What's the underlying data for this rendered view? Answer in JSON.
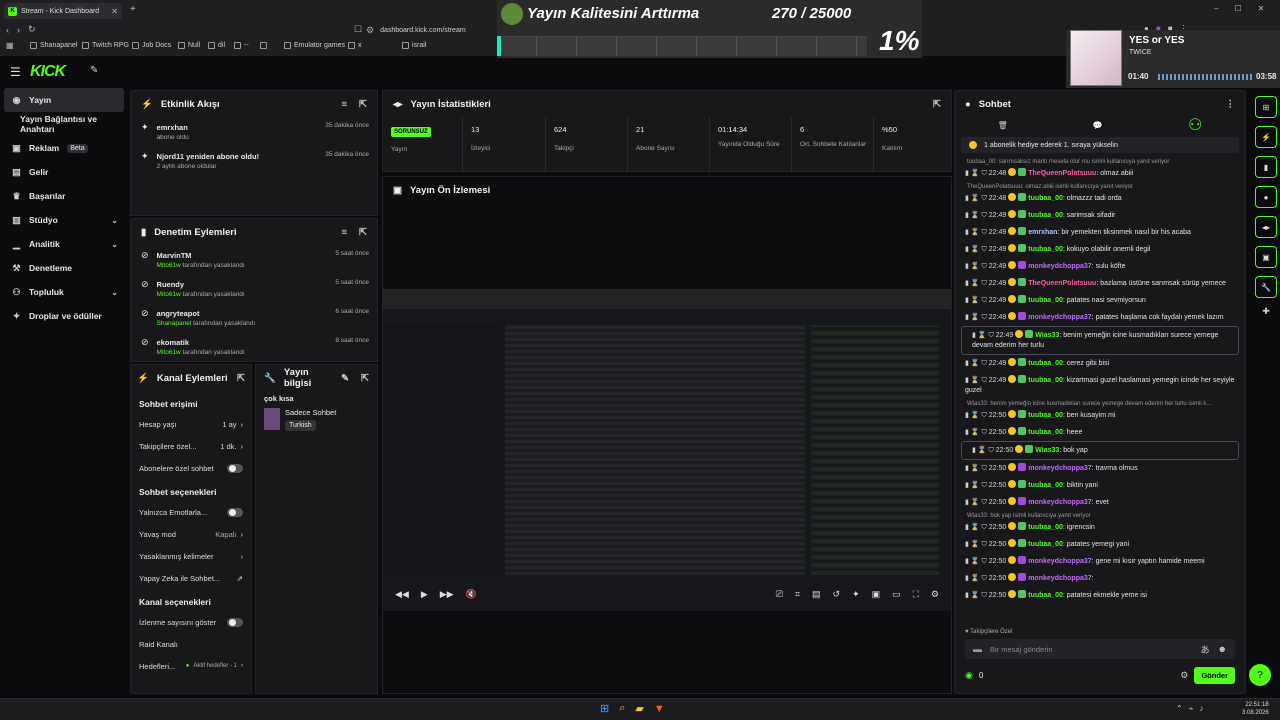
{
  "browser": {
    "tab_title": "Stream - Kick Dashboard",
    "new_tab": "+",
    "url": "dashboard.kick.com/stream",
    "bookmarks": [
      "Shanapanel",
      "Twitch RPG",
      "Job Docs",
      "Null",
      "dil",
      "--",
      "",
      "Emulator games",
      "x",
      "israil"
    ]
  },
  "overlay": {
    "title": "Yayın Kalitesini Arttırma",
    "count": "270 / 25000",
    "percent": "1%",
    "progress": 0.01
  },
  "music": {
    "title": "YES or YES",
    "artist": "TWICE",
    "elapsed": "01:40",
    "duration": "03:58",
    "progress": 0.42
  },
  "kick": {
    "logo": "KICK"
  },
  "sidebar": {
    "items": [
      {
        "label": "Yayın",
        "icon": "broadcast-icon",
        "active": true
      },
      {
        "label": "Yayın Bağlantısı ve Anahtarı",
        "icon": ""
      },
      {
        "label": "Reklam",
        "icon": "ad-icon",
        "badge": "Beta"
      },
      {
        "label": "Gelir",
        "icon": "wallet-icon"
      },
      {
        "label": "Başarılar",
        "icon": "trophy-icon"
      },
      {
        "label": "Stüdyo",
        "icon": "studio-icon",
        "chevron": true
      },
      {
        "label": "Analitik",
        "icon": "chart-icon",
        "chevron": true
      },
      {
        "label": "Denetleme",
        "icon": "hammer-icon"
      },
      {
        "label": "Topluluk",
        "icon": "users-icon",
        "chevron": true
      },
      {
        "label": "Droplar ve ödüller",
        "icon": "gift-icon"
      }
    ]
  },
  "activity": {
    "title": "Etkinlik Akışı",
    "items": [
      {
        "name": "emrxhan",
        "desc": "abone oldu",
        "time": "35 dakika önce"
      },
      {
        "name": "Njord11 yeniden abone oldu!",
        "desc": "2 aylık abone oldular",
        "time": "35 dakika önce"
      }
    ]
  },
  "mod": {
    "title": "Denetim Eylemleri",
    "items": [
      {
        "name": "MarvinTM",
        "by": "Mito61w",
        "desc": "tarafından yasaklandı",
        "time": "5 saat önce"
      },
      {
        "name": "Ruendy",
        "by": "Mito61w",
        "desc": "tarafından yasaklandı",
        "time": "5 saat önce"
      },
      {
        "name": "angryteapot",
        "by": "Shanapanel",
        "desc": "tarafından yasaklandı",
        "time": "6 saat önce"
      },
      {
        "name": "ekomatik",
        "by": "Mito61w",
        "desc": "tarafından yasaklandı",
        "time": "8 saat önce"
      }
    ]
  },
  "channel": {
    "title": "Kanal Eylemleri",
    "chat_access": "Sohbet erişimi",
    "account_age": "Hesap yaşı",
    "account_age_val": "1 ay",
    "followers_only": "Takipçilere özel...",
    "followers_only_val": "1 dk.",
    "subs_only": "Abonelere özel sohbet",
    "chat_options": "Sohbet seçenekleri",
    "emotes_only": "Yalnızca Emotlarla...",
    "slow_mode": "Yavaş mod",
    "slow_mode_val": "Kapalı",
    "banned_words": "Yasaklanmış kelimeler",
    "ai_chat": "Yapay Zeka ile Sohbet...",
    "channel_options": "Kanal seçenekleri",
    "show_viewers": "İzlenme sayısını göster",
    "raid": "Raid Kanalı",
    "goals": "Hedefleri...",
    "goals_val": "Aktif hedefler - 1"
  },
  "info": {
    "title": "Yayın bilgisi",
    "stream_title": "çok kısa",
    "category": "Sadece Sohbet",
    "language": "Turkish"
  },
  "stats": {
    "title": "Yayın İstatistikleri",
    "badge": "SORUNSUZ",
    "items": [
      {
        "value": "",
        "label": "Yayın"
      },
      {
        "value": "13",
        "label": "İzleyici"
      },
      {
        "value": "624",
        "label": "Takipçi"
      },
      {
        "value": "21",
        "label": "Abone Sayısı"
      },
      {
        "value": "01:14:34",
        "label": "Yayında Olduğu Süre"
      },
      {
        "value": "6",
        "label": "Ort. Sohbete Katılanlar"
      },
      {
        "value": "%50",
        "label": "Katılım"
      }
    ]
  },
  "preview": {
    "title": "Yayın Ön İzlemesi"
  },
  "chat": {
    "title": "Sohbet",
    "pinned": "1 abonelik hediye ederek 1. sıraya yükselin",
    "reply_prefix": "İsmi kullanıcıya yanıt veriyor",
    "followers_only": "Takipçilere Özel",
    "placeholder": "Bir mesaj gönderin",
    "send": "Gönder",
    "count": "0",
    "messages": [
      {
        "reply": "tuubaa_00: sarımsaksız mantı mesela olur mu isimli kullanıcıya yanıt veriyor",
        "time": "22:48",
        "user": "TheQueenPolatsuuu",
        "color": "n-pink",
        "text": "olmaz.abiii"
      },
      {
        "reply": "TheQueenPolatsuuu: olmaz.abiii isimli kullanıcıya yanıt veriyor",
        "time": "22:48",
        "user": "tuubaa_00",
        "color": "n-green",
        "text": "olmazzz tadi orda"
      },
      {
        "time": "22:49",
        "user": "tuubaa_00",
        "color": "n-green",
        "text": "sarimsak sifadir"
      },
      {
        "time": "22:49",
        "user": "emrxhan",
        "color": "n-blue",
        "text": "bir yemekten tiksinmek nasıl bir his acaba"
      },
      {
        "time": "22:49",
        "user": "tuubaa_00",
        "color": "n-green",
        "text": "kokuyo olabilir onemli degil"
      },
      {
        "time": "22:49",
        "user": "monkeydchoppa37",
        "color": "n-violet",
        "text": "sulu köfte"
      },
      {
        "time": "22:49",
        "user": "TheQueenPolatsuuu",
        "color": "n-pink",
        "text": "bazlama üstüne sarımsak sürüp yemece"
      },
      {
        "time": "22:49",
        "user": "tuubaa_00",
        "color": "n-green",
        "text": "patates nasi sevmiyorsun"
      },
      {
        "time": "22:49",
        "user": "monkeydchoppa37",
        "color": "n-violet",
        "text": "patates haşlama cok faydalı yemek lazım"
      },
      {
        "time": "22:49",
        "user": "Wias33",
        "color": "n-green",
        "text": "benim yemeğin icine kusmadıkları surece yemege devam ederim her turlu",
        "hl": true
      },
      {
        "time": "22:49",
        "user": "tuubaa_00",
        "color": "n-green",
        "text": "cerez gibi bisi"
      },
      {
        "time": "22:49",
        "user": "tuubaa_00",
        "color": "n-green",
        "text": "kizartmasi guzel haslamasi yemegin icinde her seyiyle guzel"
      },
      {
        "reply": "Wias33: benim yemeğin icine kusmadıkları surece yemege devam ederim her turlu isimli k...",
        "time": "22:50",
        "user": "tuubaa_00",
        "color": "n-green",
        "text": "ben kusayim mi"
      },
      {
        "time": "22:50",
        "user": "tuubaa_00",
        "color": "n-green",
        "text": "heee"
      },
      {
        "time": "22:50",
        "user": "Wias33",
        "color": "n-green",
        "text": "bok yap",
        "hl": true
      },
      {
        "time": "22:50",
        "user": "monkeydchoppa37",
        "color": "n-violet",
        "text": "travma olmus"
      },
      {
        "time": "22:50",
        "user": "tuubaa_00",
        "color": "n-green",
        "text": "biktin yani"
      },
      {
        "time": "22:50",
        "user": "monkeydchoppa37",
        "color": "n-violet",
        "text": "evet"
      },
      {
        "reply": "Wias33: bok yap isimli kullanıcıya yanıt veriyor",
        "time": "22:50",
        "user": "tuubaa_00",
        "color": "n-green",
        "text": "igrencsin"
      },
      {
        "time": "22:50",
        "user": "tuubaa_00",
        "color": "n-green",
        "text": "patates yemegi yani"
      },
      {
        "time": "22:50",
        "user": "monkeydchoppa37",
        "color": "n-violet",
        "text": "gene mi kısır yaptın hamide meemi"
      },
      {
        "time": "22:50",
        "user": "monkeydchoppa37",
        "color": "n-violet",
        "text": ""
      },
      {
        "time": "22:50",
        "user": "tuubaa_00",
        "color": "n-green",
        "text": "patatesi ekmekle yeme isi"
      }
    ]
  },
  "taskbar": {
    "time": "22:51:18",
    "date": "3.08.2026"
  },
  "colors": {
    "accent": "#53fc18",
    "panel": "#18181b",
    "bg": "#0b0b0d"
  }
}
